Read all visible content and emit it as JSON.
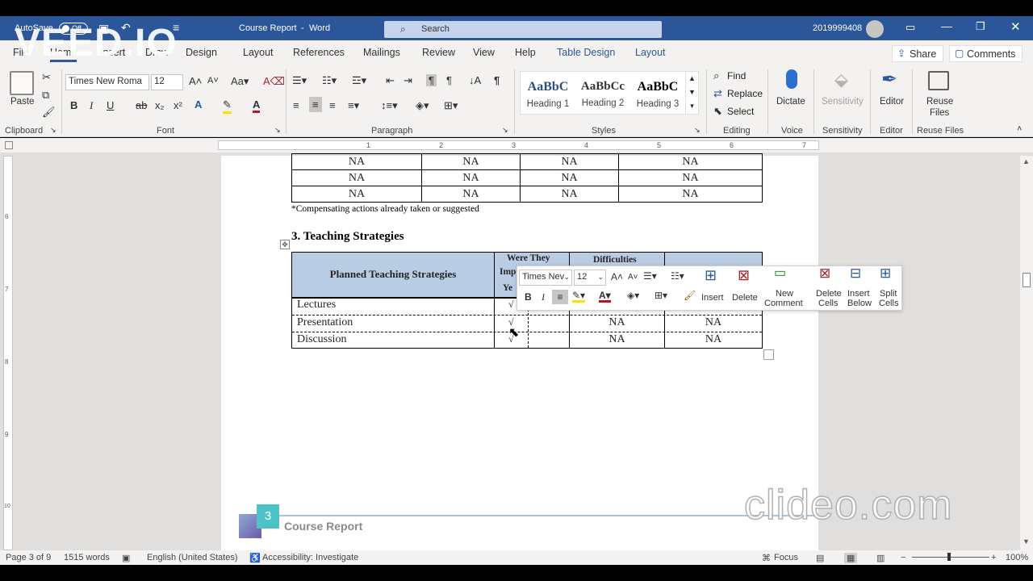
{
  "window": {
    "autosave_label": "AutoSave",
    "autosave_state": "Off",
    "doc_title": "Course Report",
    "app_sep": "-",
    "app_name": "Word",
    "search_placeholder": "Search",
    "user_id": "2019999408"
  },
  "ribbon_tabs": [
    "File",
    "Home",
    "Insert",
    "Draw",
    "Design",
    "Layout",
    "References",
    "Mailings",
    "Review",
    "View",
    "Help",
    "Table Design",
    "Layout"
  ],
  "share_label": "Share",
  "comments_label": "Comments",
  "clipboard": {
    "paste": "Paste",
    "group": "Clipboard"
  },
  "font": {
    "name": "Times New Roma",
    "size": "12",
    "group": "Font"
  },
  "paragraph": {
    "group": "Paragraph"
  },
  "styles": {
    "group": "Styles",
    "items": [
      {
        "sample": "AaBbC",
        "name": "Heading 1"
      },
      {
        "sample": "AaBbCc",
        "name": "Heading 2"
      },
      {
        "sample": "AaBbC",
        "name": "Heading 3"
      }
    ]
  },
  "editing": {
    "find": "Find",
    "replace": "Replace",
    "select": "Select",
    "group": "Editing"
  },
  "voice": {
    "dictate": "Dictate",
    "group": "Voice"
  },
  "sensitivity": {
    "label": "Sensitivity",
    "group": "Sensitivity"
  },
  "editor": {
    "label": "Editor",
    "group": "Editor"
  },
  "reuse": {
    "label1": "Reuse",
    "label2": "Files",
    "group": "Reuse Files"
  },
  "ruler": [
    "1",
    "2",
    "3",
    "4",
    "5",
    "6",
    "7"
  ],
  "vruler": [
    "6",
    "7",
    "8",
    "9",
    "10"
  ],
  "doc": {
    "top_rows": [
      [
        "NA",
        "NA",
        "NA",
        "NA"
      ],
      [
        "NA",
        "NA",
        "NA",
        "NA"
      ],
      [
        "NA",
        "NA",
        "NA",
        "NA"
      ]
    ],
    "footnote": "*Compensating actions already taken or suggested",
    "heading": "3. Teaching Strategies",
    "th_planned": "Planned Teaching Strategies",
    "th_were": "Were They",
    "th_imp": "Imp",
    "th_yes": "Ye",
    "th_diff": "Difficulties",
    "rows": [
      {
        "name": "Lectures",
        "check": "√",
        "c2": "",
        "c3": ""
      },
      {
        "name": "Presentation",
        "check": "√",
        "c2": "NA",
        "c3": "NA"
      },
      {
        "name": "Discussion",
        "check": "√",
        "c2": "NA",
        "c3": "NA"
      }
    ],
    "footer_num": "3",
    "footer_title": "Course Report"
  },
  "minibar": {
    "font": "Times Nev",
    "size": "12",
    "insert": "Insert",
    "delete": "Delete",
    "new_comment_1": "New",
    "new_comment_2": "Comment",
    "delete_cells_1": "Delete",
    "delete_cells_2": "Cells",
    "insert_below_1": "Insert",
    "insert_below_2": "Below",
    "split_cells_1": "Split",
    "split_cells_2": "Cells"
  },
  "status": {
    "page": "Page 3 of 9",
    "words": "1515 words",
    "lang": "English (United States)",
    "access": "Accessibility: Investigate",
    "focus": "Focus",
    "zoom": "100%"
  },
  "watermarks": {
    "veed": "VEED.IO",
    "clideo": "clideo.com"
  }
}
